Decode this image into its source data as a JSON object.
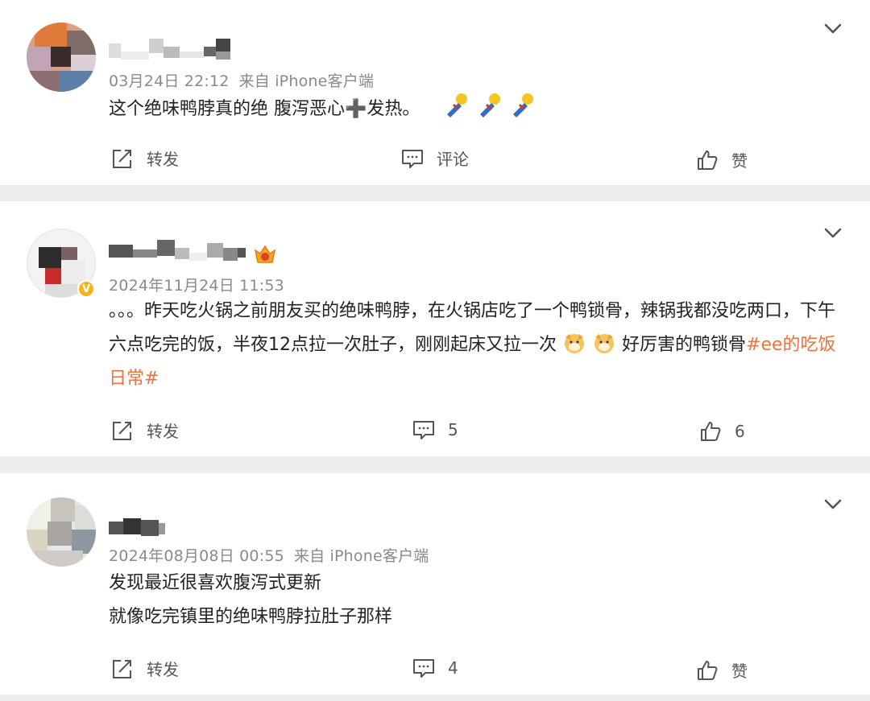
{
  "comments": [
    {
      "username": "",
      "time": "03月24日 22:12",
      "source": "来自 iPhone客户端",
      "content_lines": [
        "这个绝味鸭脖真的绝 腹泻恶心➕发热。"
      ],
      "emojis": [
        "broken-heart-pin-emoji",
        "broken-heart-pin-emoji",
        "broken-heart-pin-emoji"
      ],
      "actions": {
        "repost": "转发",
        "comment": "评论",
        "like": "赞"
      }
    },
    {
      "username": "",
      "time": "2024年11月24日 11:53",
      "source": "",
      "content_before_emoji": "。。。昨天吃火锅之前朋友买的绝味鸭脖，在火锅店吃了一个鸭锁骨，辣锅我都没吃两口，下午六点吃完的饭，半夜12点拉一次肚子，刚刚起床又拉一次",
      "content_after_emoji": "好厉害的鸭锁骨",
      "hashtag": "#ee的吃饭日常#",
      "emojis": [
        "dog-emoji",
        "dog-emoji"
      ],
      "actions": {
        "repost": "转发",
        "comment": "5",
        "like": "6"
      }
    },
    {
      "username": "",
      "time": "2024年08月08日 00:55",
      "source": "来自 iPhone客户端",
      "content_lines": [
        "发现最近很喜欢腹泻式更新",
        "就像吃完镇里的绝味鸭脖拉肚子那样"
      ],
      "actions": {
        "repost": "转发",
        "comment": "4",
        "like": "赞"
      }
    }
  ],
  "colors": {
    "hashtag": "#eb7340",
    "meta": "#8a8a8a",
    "verified": "#f7b51c"
  }
}
